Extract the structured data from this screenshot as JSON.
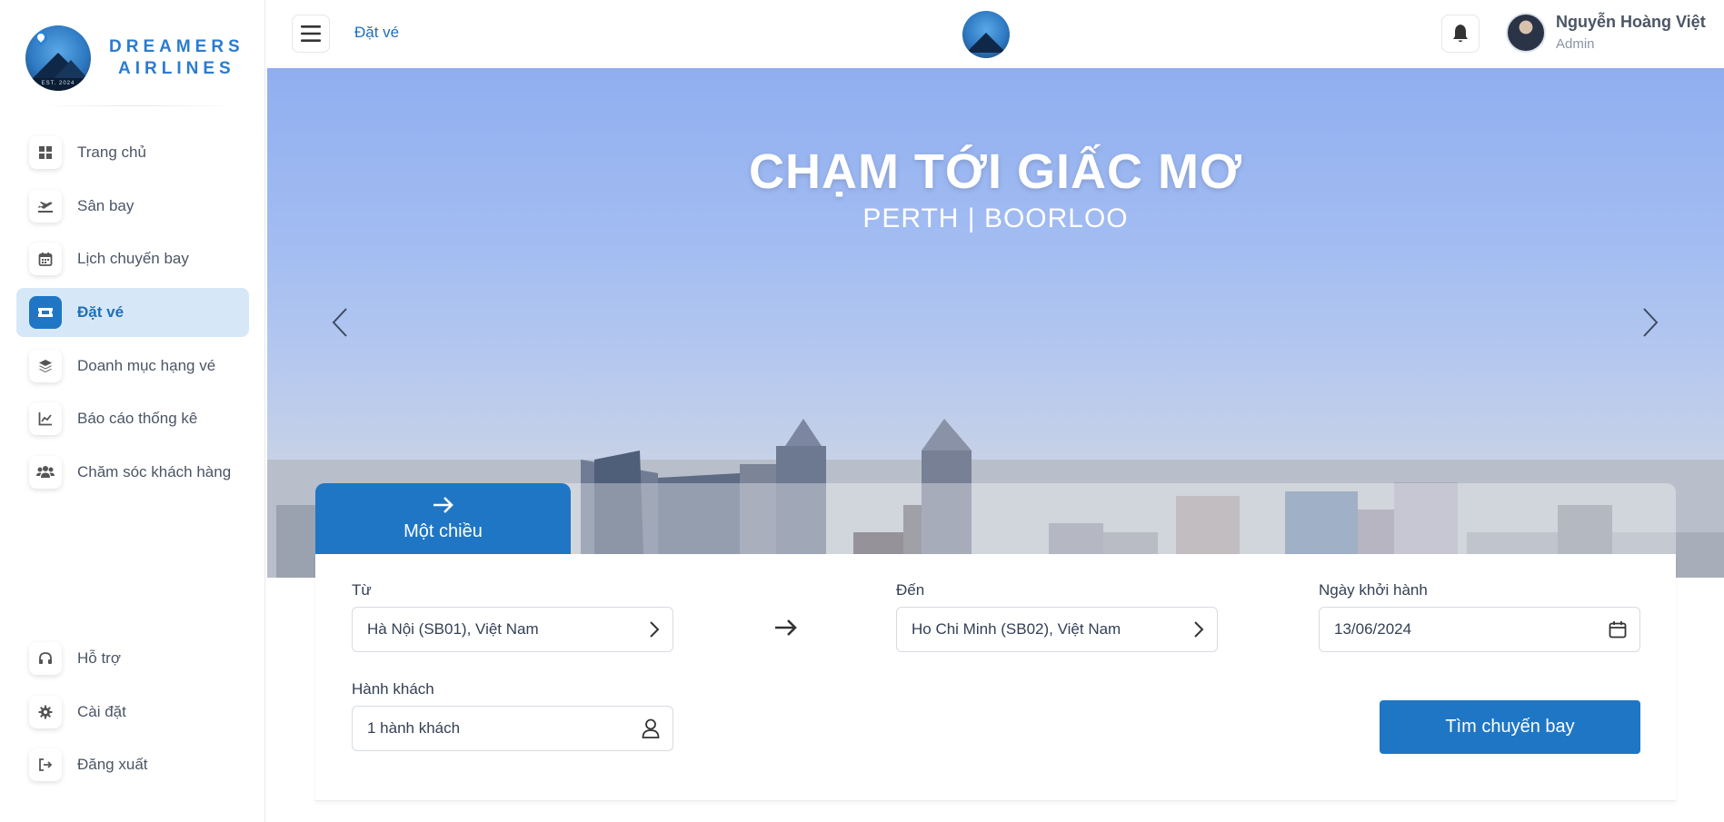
{
  "brand": {
    "line1": "DREAMERS",
    "line2": "AIRLINES",
    "badge_text": "EST. 2024"
  },
  "sidebar": {
    "items": [
      {
        "label": "Trang chủ",
        "icon": "windows-grid-icon"
      },
      {
        "label": "Sân bay",
        "icon": "plane-takeoff-icon"
      },
      {
        "label": "Lịch chuyến bay",
        "icon": "calendar-icon"
      },
      {
        "label": "Đặt vé",
        "icon": "ticket-icon",
        "active": true
      },
      {
        "label": "Doanh mục hạng vé",
        "icon": "layers-icon"
      },
      {
        "label": "Báo cáo thống kê",
        "icon": "line-chart-icon"
      },
      {
        "label": "Chăm sóc khách hàng",
        "icon": "users-icon"
      }
    ],
    "bottom_items": [
      {
        "label": "Hỗ trợ",
        "icon": "headset-icon"
      },
      {
        "label": "Cài đặt",
        "icon": "gear-icon"
      },
      {
        "label": "Đăng xuất",
        "icon": "logout-icon"
      }
    ]
  },
  "header": {
    "breadcrumb": "Đặt vé",
    "user": {
      "name": "Nguyễn Hoàng Việt",
      "role": "Admin"
    }
  },
  "hero": {
    "title": "CHẠM TỚI GIẤC MƠ",
    "subtitle": "PERTH | BOORLOO"
  },
  "booking": {
    "tab_label": "Một chiều",
    "from_label": "Từ",
    "from_value": "Hà Nội (SB01), Việt Nam",
    "to_label": "Đến",
    "to_value": "Ho Chi Minh (SB02), Việt Nam",
    "date_label": "Ngày khởi hành",
    "date_value": "13/06/2024",
    "passengers_label": "Hành khách",
    "passengers_value": "1 hành khách",
    "search_button": "Tìm chuyến bay"
  },
  "colors": {
    "primary": "#1f76c5",
    "active_bg": "#d6e8f7",
    "text": "#344054"
  }
}
